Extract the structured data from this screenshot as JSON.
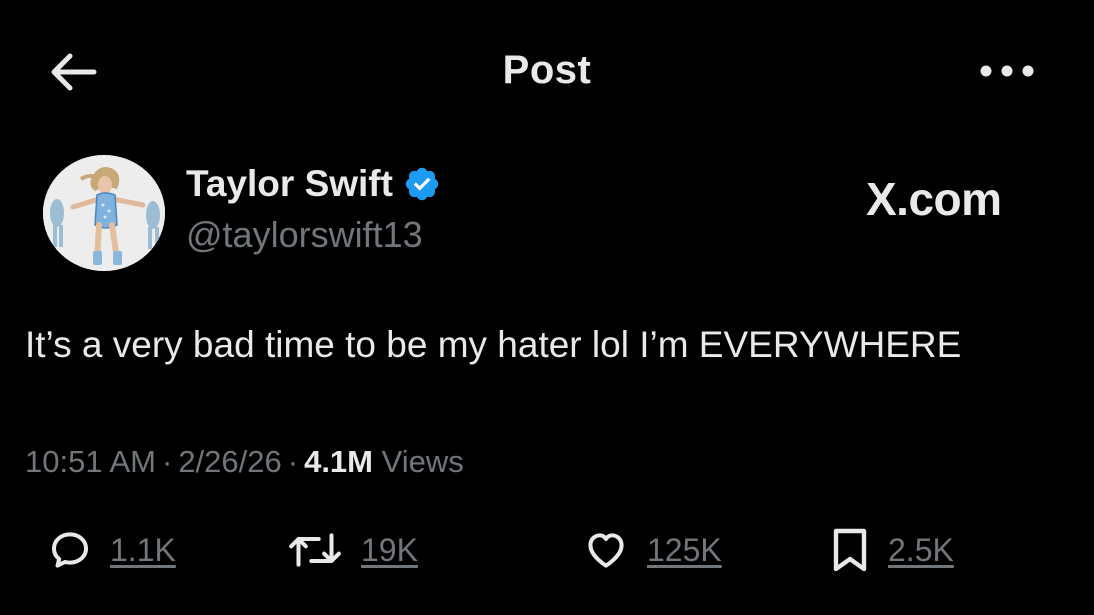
{
  "header": {
    "title": "Post",
    "back_icon": "arrow-left-icon",
    "more_icon": "more-horizontal-icon"
  },
  "author": {
    "name": "Taylor Swift",
    "handle": "@taylorswift13",
    "verified": true,
    "verified_color": "#1d9bf0",
    "avatar": "avatar-photo"
  },
  "brand_mark": "X.com",
  "post": {
    "text": "It’s a very bad time to be my hater lol I’m EVERYWHERE",
    "time": "10:51 AM",
    "separator": "·",
    "date": "2/26/26",
    "views_count": "4.1M",
    "views_label": "Views"
  },
  "actions": {
    "reply": {
      "icon": "reply-icon",
      "count": "1.1K"
    },
    "repost": {
      "icon": "repost-icon",
      "count": "19K"
    },
    "like": {
      "icon": "heart-icon",
      "count": "125K"
    },
    "bookmark": {
      "icon": "bookmark-icon",
      "count": "2.5K"
    }
  },
  "colors": {
    "background": "#000000",
    "primary_text": "#e7e9ea",
    "secondary_text": "#71767b",
    "accent": "#1d9bf0"
  }
}
